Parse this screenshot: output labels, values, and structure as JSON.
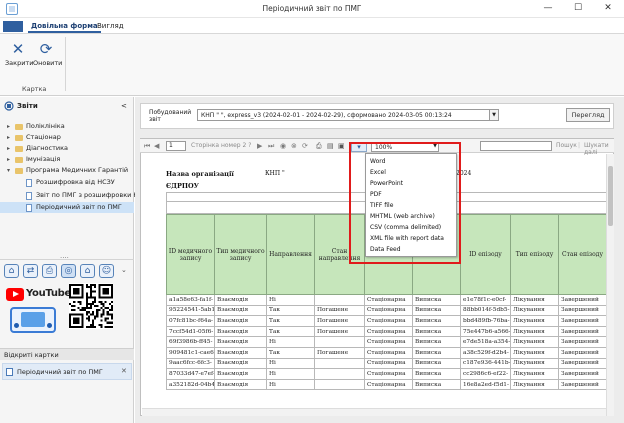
{
  "window": {
    "title": "Періодичний звіт по ПМГ",
    "minimize": "—",
    "maximize": "☐",
    "close": "✕"
  },
  "ribbon": {
    "tabs": [
      "Довільна форма",
      "Вигляд"
    ],
    "buttons": [
      {
        "label": "Закрити",
        "icon": "close-icon",
        "glyph": "✕"
      },
      {
        "label": "Оновити",
        "icon": "refresh-icon",
        "glyph": "⟳"
      }
    ],
    "group_label": "Картка"
  },
  "leftpanel": {
    "title": "Звіти",
    "collapse": "<",
    "tree": [
      {
        "label": "Поліклініка",
        "kind": "folder"
      },
      {
        "label": "Стаціонар",
        "kind": "folder"
      },
      {
        "label": "Діагностика",
        "kind": "folder"
      },
      {
        "label": "Імунізація",
        "kind": "folder"
      },
      {
        "label": "Програма Медичних Гарантій",
        "kind": "folder",
        "expanded": true
      },
      {
        "label": "Розшифровка від НСЗУ",
        "kind": "doc"
      },
      {
        "label": "Звіт по ПМГ з розшифровки НСЗ",
        "kind": "doc"
      },
      {
        "label": "Періодичний звіт по ПМГ",
        "kind": "doc",
        "selected": true
      }
    ],
    "dots": "....",
    "youtube": "YouTube",
    "open_cards_title": "Відкриті картки",
    "open_card": "Періодичний звіт по ПМГ",
    "open_card_close": "✕"
  },
  "params": {
    "label": "Побудований звіт",
    "value": "КНП \"                                    \", express_v3 (2024-02-01 - 2024-02-29), сформовано 2024-03-05 00:13:24",
    "preview": "Перегляд"
  },
  "toolbar": {
    "page_value": "1",
    "page_text": "Сторінка номер 2 ?",
    "zoom": "100%",
    "search_label": "Пошук",
    "find_next": "Шукати далі"
  },
  "export_menu": [
    "Word",
    "Excel",
    "PowerPoint",
    "PDF",
    "TIFF file",
    "MHTML (web archive)",
    "CSV (comma delimited)",
    "XML file with report data",
    "Data Feed"
  ],
  "report": {
    "org_label": "Назва організації",
    "org_value": "КНП \"",
    "edrpou_label": "ЄДРПОУ",
    "period_fragment": "2024",
    "columns": [
      "ID медичного запису",
      "Тип медичного запису",
      "Направлення",
      "Стан направлення",
      "",
      "",
      "ID епізоду",
      "Тип епізоду",
      "Стан епізоду"
    ],
    "rows": [
      [
        "a1a58e63-fa1f-",
        "Взаємодія",
        "Ні",
        "",
        "Стаціонарна",
        "Виписка",
        "e1e78f1c-e0cf-",
        "Лікування",
        "Завершений"
      ],
      [
        "95224541-5ab1-",
        "Взаємодія",
        "Так",
        "Погашене",
        "Стаціонарна",
        "Виписка",
        "88bb014f-5db5-",
        "Лікування",
        "Завершений"
      ],
      [
        "07fc81bc-f64a-",
        "Взаємодія",
        "Так",
        "Погашене",
        "Стаціонарна",
        "Виписка",
        "bbd489fb-76ba-",
        "Лікування",
        "Завершений"
      ],
      [
        "7ccf54d1-05f6-",
        "Взаємодія",
        "Так",
        "Погашене",
        "Стаціонарна",
        "Виписка",
        "75e447b6-a566-",
        "Лікування",
        "Завершений"
      ],
      [
        "69f3986b-ff45-",
        "Взаємодія",
        "Ні",
        "",
        "Стаціонарна",
        "Виписка",
        "e7de518a-a354-",
        "Лікування",
        "Завершений"
      ],
      [
        "909481c1-cae6-",
        "Взаємодія",
        "Так",
        "Погашене",
        "Стаціонарна",
        "Виписка",
        "a38c529f-d2b4-",
        "Лікування",
        "Завершений"
      ],
      [
        "9aac6fcc-6fc3-",
        "Взаємодія",
        "Ні",
        "",
        "Стаціонарна",
        "Виписка",
        "c187e936-441b-",
        "Лікування",
        "Завершений"
      ],
      [
        "87033d47-e7ef-",
        "Взаємодія",
        "Ні",
        "",
        "Стаціонарна",
        "Виписка",
        "cc2986c6-ef22-",
        "Лікування",
        "Завершений"
      ],
      [
        "a352182d-04b4-",
        "Взаємодія",
        "Ні",
        "",
        "Стаціонарна",
        "Виписка",
        "16e8a2ed-f5d1-",
        "Лікування",
        "Завершений"
      ]
    ]
  },
  "colors": {
    "accent": "#2f5f9f",
    "header_green": "#c6e6bb",
    "highlight_red": "#e01b1b",
    "selected": "#cde2f7"
  }
}
